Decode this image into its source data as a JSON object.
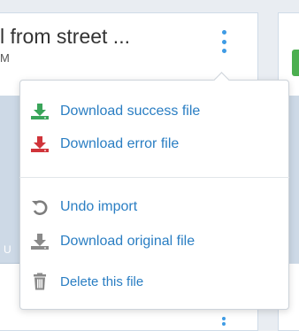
{
  "card": {
    "title": "l from street ...",
    "subtitle": "M",
    "band_letter": "U"
  },
  "menu": {
    "items": [
      {
        "label": "Download success file",
        "icon": "download-icon",
        "icon_color": "#3aa55a"
      },
      {
        "label": "Download error file",
        "icon": "download-icon",
        "icon_color": "#d0343a"
      },
      {
        "label": "Undo import",
        "icon": "undo-icon",
        "icon_color": "#7d7d7d"
      },
      {
        "label": "Download original file",
        "icon": "download-icon",
        "icon_color": "#8a8a8a"
      },
      {
        "label": "Delete this file",
        "icon": "trash-icon",
        "icon_color": "#8a8a8a"
      }
    ]
  },
  "colors": {
    "link": "#2a7ec3",
    "kebab": "#3f9be4",
    "band": "#cdd9e6"
  }
}
